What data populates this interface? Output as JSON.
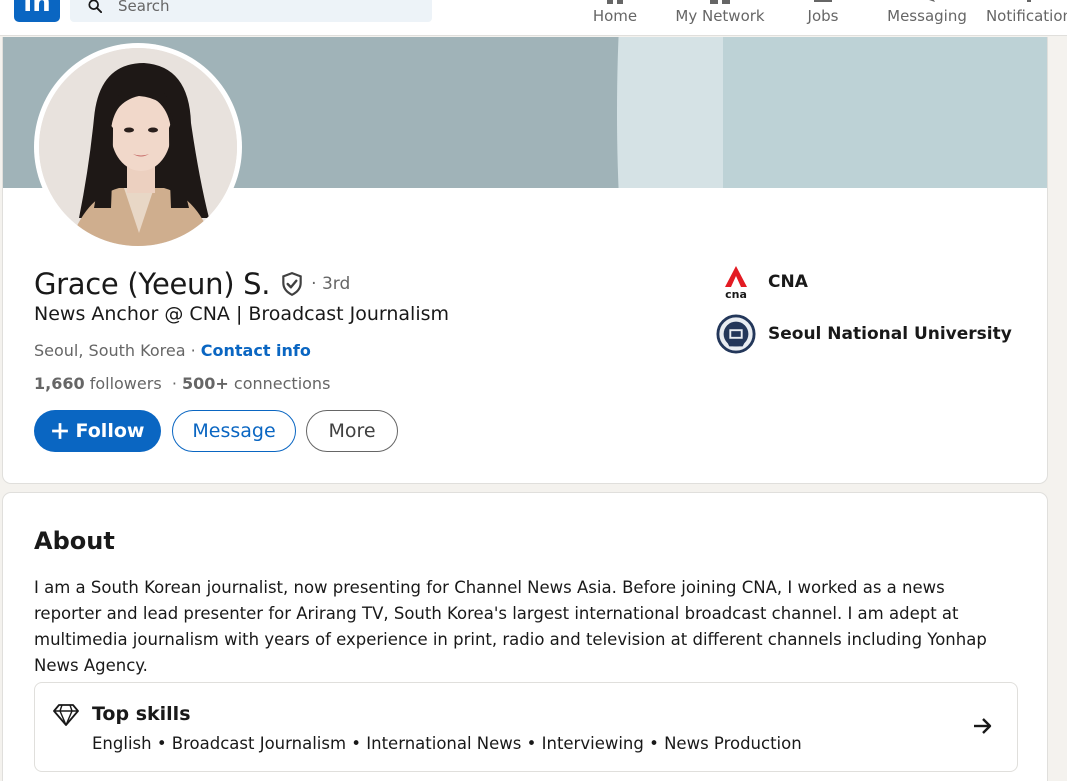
{
  "nav": {
    "logo_text": "in",
    "search_placeholder": "Search",
    "items": [
      {
        "label": "Home",
        "icon": "home-icon"
      },
      {
        "label": "My Network",
        "icon": "network-icon"
      },
      {
        "label": "Jobs",
        "icon": "briefcase-icon"
      },
      {
        "label": "Messaging",
        "icon": "message-icon"
      },
      {
        "label": "Notification",
        "icon": "bell-icon"
      }
    ]
  },
  "profile": {
    "name": "Grace (Yeeun) S.",
    "degree": "· 3rd",
    "headline": "News Anchor @ CNA | Broadcast Journalism",
    "location": "Seoul, South Korea",
    "separator": " · ",
    "contact_label": "Contact info",
    "followers_count": "1,660",
    "followers_label": "followers",
    "connections_count": "500+",
    "connections_label": "connections",
    "buttons": {
      "follow": "Follow",
      "message": "Message",
      "more": "More"
    },
    "organizations": [
      {
        "name": "CNA",
        "logo": "cna-logo",
        "logo_text": "cna"
      },
      {
        "name": "Seoul National University",
        "logo": "snu-logo"
      }
    ]
  },
  "about": {
    "title": "About",
    "text": "I am a South Korean journalist, now presenting for Channel News Asia. Before joining CNA, I worked as a news reporter and lead presenter for Arirang TV, South Korea's largest international broadcast channel. I am adept at multimedia journalism with years of experience in print, radio and television at different channels including Yonhap News Agency.",
    "top_skills_title": "Top skills",
    "top_skills": "English • Broadcast Journalism • International News • Interviewing • News Production"
  },
  "colors": {
    "brand": "#0a66c2",
    "cna_red": "#e31b23"
  }
}
